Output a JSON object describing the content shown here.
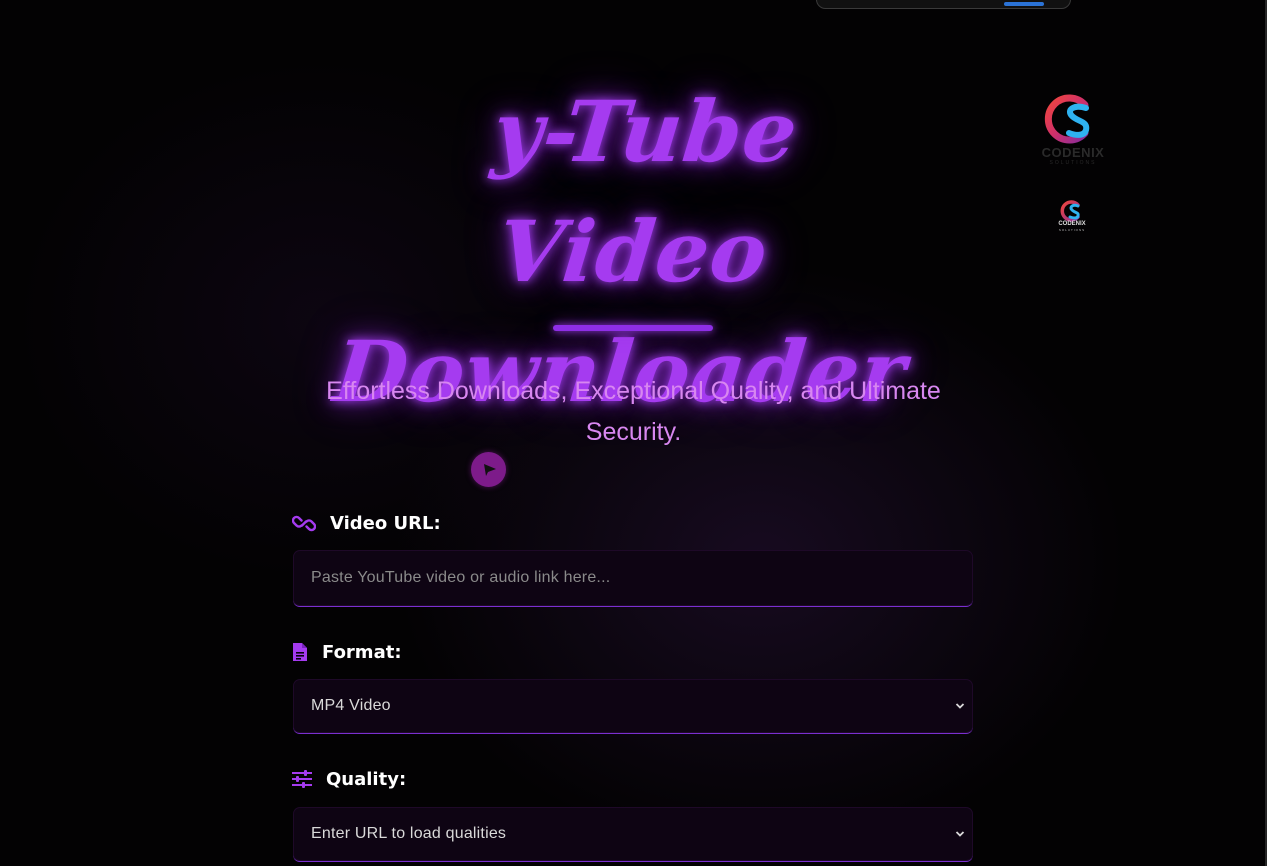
{
  "hero": {
    "title_line1": "y-Tube Video",
    "title_line2": "Downloader",
    "tagline": "Effortless Downloads, Exceptional Quality, and Ultimate Security."
  },
  "brand": {
    "name": "CODENIX",
    "sub": "SOLUTIONS"
  },
  "form": {
    "url_label": "Video URL:",
    "url_placeholder": "Paste YouTube video or audio link here...",
    "format_label": "Format:",
    "format_selected": "MP4 Video",
    "quality_label": "Quality:",
    "quality_selected": "Enter URL to load qualities"
  },
  "icons": {
    "url": "link-icon",
    "format": "file-icon",
    "quality": "sliders-icon",
    "play": "play-icon"
  },
  "colors": {
    "accent": "#a53bf0",
    "tagline": "#d887f0",
    "field_bg": "#0e0413",
    "field_border": "#7a2fd0"
  }
}
